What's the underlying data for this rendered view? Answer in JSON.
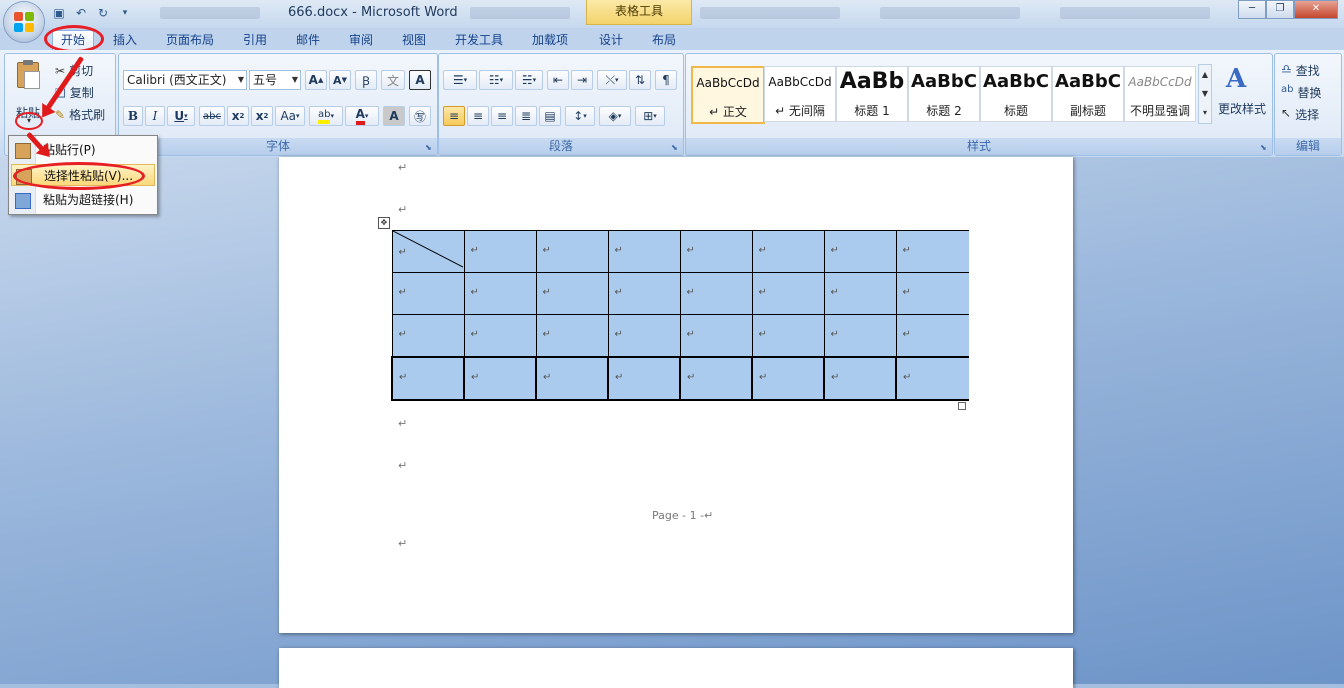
{
  "window": {
    "title": "666.docx - Microsoft Word",
    "context_tab": "表格工具"
  },
  "tabs": [
    "开始",
    "插入",
    "页面布局",
    "引用",
    "邮件",
    "审阅",
    "视图",
    "开发工具",
    "加载项",
    "设计",
    "布局"
  ],
  "ribbon": {
    "clipboard": {
      "paste": "粘贴",
      "cut": "剪切",
      "copy": "复制",
      "format_painter": "格式刷"
    },
    "font": {
      "name": "Calibri (西文正文)",
      "size": "五号",
      "label": "字体"
    },
    "paragraph": {
      "label": "段落"
    },
    "styles": {
      "label": "样式",
      "items": [
        {
          "sample": "AaBbCcDd",
          "name": "↵ 正文"
        },
        {
          "sample": "AaBbCcDd",
          "name": "↵ 无间隔"
        },
        {
          "sample": "AaBb",
          "name": "标题 1"
        },
        {
          "sample": "AaBbC",
          "name": "标题 2"
        },
        {
          "sample": "AaBbC",
          "name": "标题"
        },
        {
          "sample": "AaBbC",
          "name": "副标题"
        },
        {
          "sample": "AaBbCcDd",
          "name": "不明显强调"
        }
      ],
      "change_styles": "更改样式"
    },
    "editing": {
      "find": "查找",
      "replace": "替换",
      "select": "选择",
      "label": "编辑"
    }
  },
  "paste_menu": {
    "items": [
      "粘贴行(P)",
      "选择性粘贴(V)...",
      "粘贴为超链接(H)"
    ]
  },
  "document": {
    "footer": "Page - 1 -↵",
    "paragraph_mark": "↵",
    "table": {
      "rows": 4,
      "cols": 8
    }
  },
  "colors": {
    "highlight": "#e81e25",
    "table_fill": "#abcbee",
    "accent": "#15428b"
  }
}
